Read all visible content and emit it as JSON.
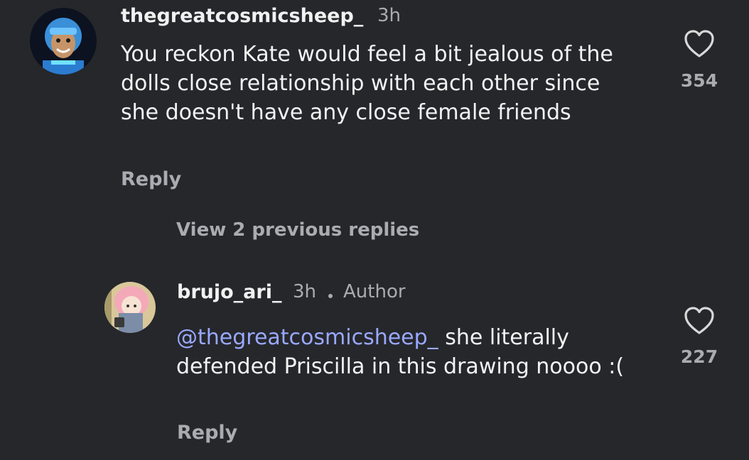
{
  "comment": {
    "username": "thegreatcosmicsheep_",
    "time": "3h",
    "text": "You reckon Kate would feel a bit jealous of the dolls close relationship with each other since she doesn't have any close female friends",
    "reply_label": "Reply",
    "like_count": "354",
    "like_icon": "heart-outline-icon"
  },
  "view_replies_label": "View 2 previous replies",
  "reply": {
    "username": "brujo_ari_",
    "time": "3h",
    "author_label": "Author",
    "mention": "@thegreatcosmicsheep_",
    "text": " she literally defended Priscilla in this drawing noooo :(",
    "reply_label": "Reply",
    "like_count": "227",
    "like_icon": "heart-outline-icon"
  },
  "colors": {
    "background": "#25272b",
    "mention": "#9aa8ff",
    "muted": "#a9acb1"
  }
}
